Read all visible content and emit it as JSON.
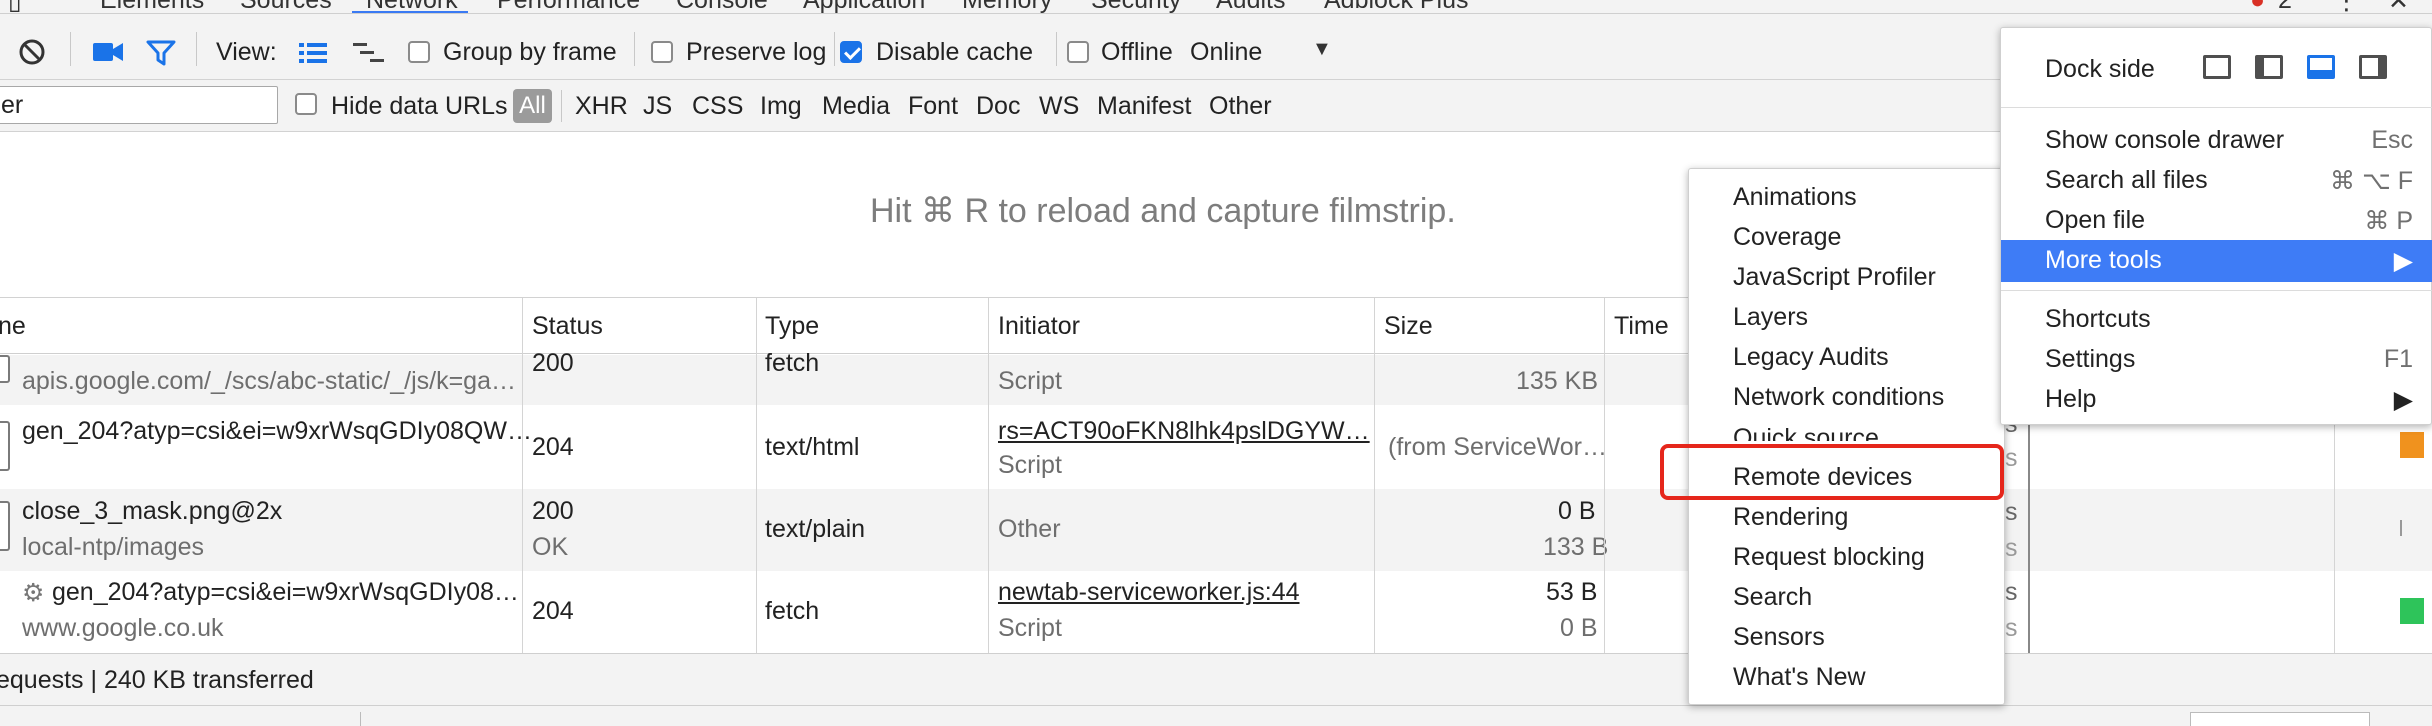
{
  "tabs": [
    {
      "label": "Elements"
    },
    {
      "label": "Sources"
    },
    {
      "label": "Network"
    },
    {
      "label": "Performance"
    },
    {
      "label": "Console"
    },
    {
      "label": "Application"
    },
    {
      "label": "Memory"
    },
    {
      "label": "Security"
    },
    {
      "label": "Audits"
    },
    {
      "label": "Adblock Plus"
    }
  ],
  "error_count": "2",
  "toolbar": {
    "view_label": "View:",
    "group_by_frame": "Group by frame",
    "preserve_log": "Preserve log",
    "disable_cache": "Disable cache",
    "disable_cache_checked": true,
    "offline": "Offline",
    "throttle": "Online"
  },
  "filterbar": {
    "filter_value": "er",
    "hide_data_urls": "Hide data URLs",
    "types": [
      "All",
      "XHR",
      "JS",
      "CSS",
      "Img",
      "Media",
      "Font",
      "Doc",
      "WS",
      "Manifest",
      "Other"
    ]
  },
  "filmstrip_message": "Hit ⌘ R to reload and capture filmstrip.",
  "table": {
    "headers": [
      "ne",
      "Status",
      "Type",
      "Initiator",
      "Size",
      "Time"
    ],
    "rows": [
      {
        "name": "apis.google.com/_/scs/abc-static/_/js/k=ga…",
        "name_sub": "",
        "status": "200",
        "status_sub": "",
        "type": "fetch",
        "initiator": "",
        "initiator_sub": "Script",
        "size": "",
        "size_sub": "135 KB"
      },
      {
        "name": "gen_204?atyp=csi&ei=w9xrWsqGDIy08QW…",
        "name_sub": "",
        "status": "204",
        "status_sub": "",
        "type": "text/html",
        "initiator": "rs=ACT90oFKN8lhk4pslDGYW…",
        "initiator_sub": "Script",
        "size": "(from ServiceWor…",
        "size_sub": ""
      },
      {
        "name": "close_3_mask.png@2x",
        "name_sub": "local-ntp/images",
        "status": "200",
        "status_sub": "OK",
        "type": "text/plain",
        "initiator": "Other",
        "initiator_sub": "",
        "size": "0 B",
        "size_sub": "133 B"
      },
      {
        "name": "gen_204?atyp=csi&ei=w9xrWsqGDIy08…",
        "name_sub": "www.google.co.uk",
        "status": "204",
        "status_sub": "",
        "type": "fetch",
        "initiator": "newtab-serviceworker.js:44",
        "initiator_sub": "Script",
        "size": "53 B",
        "size_sub": "0 B"
      }
    ]
  },
  "status_bar": "equests | 240 KB transferred",
  "more_tools_menu": [
    "Animations",
    "Coverage",
    "JavaScript Profiler",
    "Layers",
    "Legacy Audits",
    "Network conditions",
    "Quick source",
    "Remote devices",
    "Rendering",
    "Request blocking",
    "Search",
    "Sensors",
    "What's New"
  ],
  "highlighted_item": "Remote devices",
  "main_menu": {
    "dock_side": "Dock side",
    "items": [
      {
        "label": "Show console drawer",
        "shortcut": "Esc"
      },
      {
        "label": "Search all files",
        "shortcut": "⌘ ⌥ F"
      },
      {
        "label": "Open file",
        "shortcut": "⌘ P"
      },
      {
        "label": "More tools",
        "shortcut": "▶"
      },
      {
        "label": "Shortcuts",
        "shortcut": ""
      },
      {
        "label": "Settings",
        "shortcut": "F1"
      },
      {
        "label": "Help",
        "shortcut": "▶"
      }
    ]
  },
  "colors": {
    "accent": "#3e7cf6",
    "highlight_box": "#e5261b",
    "error_badge": "#d93025"
  }
}
